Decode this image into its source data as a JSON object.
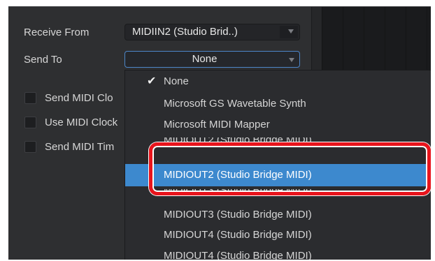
{
  "form": {
    "receive_from_label": "Receive From",
    "receive_from_value": "MIDIIN2 (Studio Brid..)",
    "send_to_label": "Send To",
    "send_to_value": "None"
  },
  "options": [
    {
      "label": "Send MIDI Clo"
    },
    {
      "label": "Use MIDI Clock"
    },
    {
      "label": "Send MIDI Tim"
    }
  ],
  "dropdown": {
    "checked_item": "None",
    "items": [
      "None",
      "Microsoft GS Wavetable Synth",
      "Microsoft MIDI Mapper",
      "MIDIOUT2 (Studio Bridge MIDI)",
      "MIDIOUT2 (Studio Bridge MIDI)",
      "MIDIOUT3 (Studio Bridge MIDI)",
      "MIDIOUT3 (Studio Bridge MIDI)",
      "MIDIOUT4 (Studio Bridge MIDI)",
      "MIDIOUT4 (Studio Bridge MIDI)"
    ],
    "selected_index": 4
  },
  "icons": {
    "check": "checkmark-icon",
    "chevron": "chevron-down-icon"
  },
  "colors": {
    "panel_bg": "#2e2f31",
    "selection": "#3d89ce",
    "highlight_ring": "#e8141c",
    "focus_border": "#4d86c8"
  }
}
